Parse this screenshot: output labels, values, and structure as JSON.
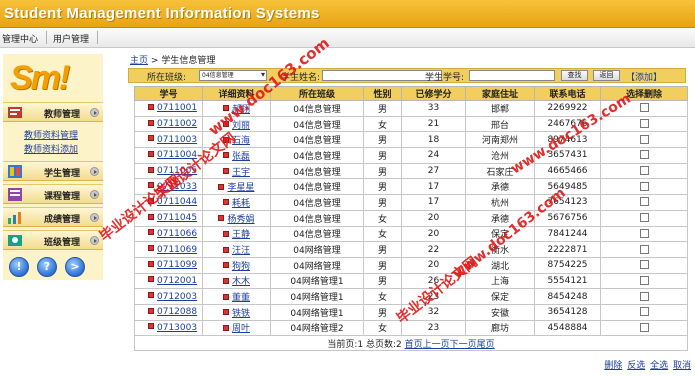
{
  "app": {
    "title": "Student Management Information Systems"
  },
  "topnav": {
    "items": [
      "管理中心",
      "用户管理"
    ]
  },
  "sidebar": {
    "logo": "Sm!",
    "menu": [
      {
        "label": "教师管理",
        "icon": "teacher-icon"
      },
      {
        "label": "学生管理",
        "icon": "student-icon"
      },
      {
        "label": "课程管理",
        "icon": "course-icon"
      },
      {
        "label": "成绩管理",
        "icon": "grades-icon"
      },
      {
        "label": "班级管理",
        "icon": "class-icon"
      }
    ],
    "submenu": [
      "教师资料管理",
      "教师资料添加"
    ],
    "bottom_buttons": [
      "!",
      "?",
      ">"
    ]
  },
  "breadcrumb": {
    "home": "主页",
    "separator": ">",
    "current": "学生信息管理"
  },
  "search": {
    "class_label": "所在班级:",
    "class_value": "04信息管理",
    "name_label": "学生姓名:",
    "name_value": "",
    "number_label": "学生学号:",
    "number_value": "",
    "search_button": "查找",
    "back_button": "返回",
    "add_link": "【添加】"
  },
  "table": {
    "columns": [
      "学号",
      "详细资料",
      "所在班级",
      "性别",
      "已修学分",
      "家庭住址",
      "联系电话",
      "选择删除"
    ],
    "rows": [
      [
        "0711001",
        "郝翔",
        "04信息管理",
        "男",
        "33",
        "邯郸",
        "2269922"
      ],
      [
        "0711002",
        "刘丽",
        "04信息管理",
        "女",
        "21",
        "邢台",
        "2467676"
      ],
      [
        "0711003",
        "石海",
        "04信息管理",
        "男",
        "18",
        "河南郑州",
        "8974613"
      ],
      [
        "0711004",
        "张磊",
        "04信息管理",
        "男",
        "24",
        "沧州",
        "3657431"
      ],
      [
        "0711005",
        "王宇",
        "04信息管理",
        "男",
        "27",
        "石家庄",
        "4665466"
      ],
      [
        "0711033",
        "李星星",
        "04信息管理",
        "男",
        "17",
        "承德",
        "5649485"
      ],
      [
        "0711044",
        "耗耗",
        "04信息管理",
        "男",
        "17",
        "杭州",
        "7654123"
      ],
      [
        "0711045",
        "杨秀娟",
        "04信息管理",
        "女",
        "20",
        "承德",
        "5676756"
      ],
      [
        "0711066",
        "王静",
        "04信息管理",
        "女",
        "20",
        "保定",
        "7841244"
      ],
      [
        "0711069",
        "汪汪",
        "04网络管理",
        "男",
        "22",
        "衡水",
        "2222871"
      ],
      [
        "0711099",
        "狗狗",
        "04网络管理",
        "男",
        "20",
        "湖北",
        "8754225"
      ],
      [
        "0712001",
        "木木",
        "04网络管理1",
        "男",
        "26",
        "上海",
        "5554121"
      ],
      [
        "0712003",
        "董董",
        "04网络管理1",
        "女",
        "23",
        "保定",
        "8454248"
      ],
      [
        "0712088",
        "铁铁",
        "04网络管理1",
        "男",
        "32",
        "安徽",
        "3654128"
      ],
      [
        "0713003",
        "周叶",
        "04网络管理2",
        "女",
        "23",
        "廊坊",
        "4548884"
      ]
    ]
  },
  "pagination": {
    "prefix": "当前页:1",
    "total_label": "总页数:2",
    "first": "首页",
    "prev": "上一页",
    "next": "下一页",
    "last": "尾页"
  },
  "bulk": [
    "删除",
    "反选",
    "全选",
    "取消"
  ],
  "watermarks": {
    "url": "www.doc163.com",
    "text": "毕业设计论文网"
  }
}
